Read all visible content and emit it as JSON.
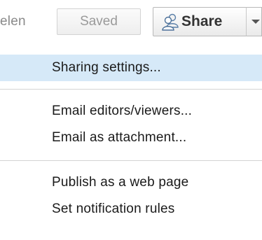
{
  "toolbar": {
    "doc_name_fragment": "elen",
    "saved_label": "Saved",
    "share_label": "Share"
  },
  "share_menu": {
    "items": [
      {
        "label": "Sharing settings...",
        "highlighted": true
      },
      {
        "label": "Email editors/viewers..."
      },
      {
        "label": "Email as attachment..."
      },
      {
        "label": "Publish as a web page"
      },
      {
        "label": "Set notification rules"
      }
    ]
  },
  "icons": {
    "share": "people-share-icon",
    "dropdown": "chevron-down-icon"
  },
  "colors": {
    "highlight": "#d6e9f8",
    "separator": "#d4d4d4",
    "text": "#1a1a1a",
    "muted_text": "#9a9a9a"
  }
}
